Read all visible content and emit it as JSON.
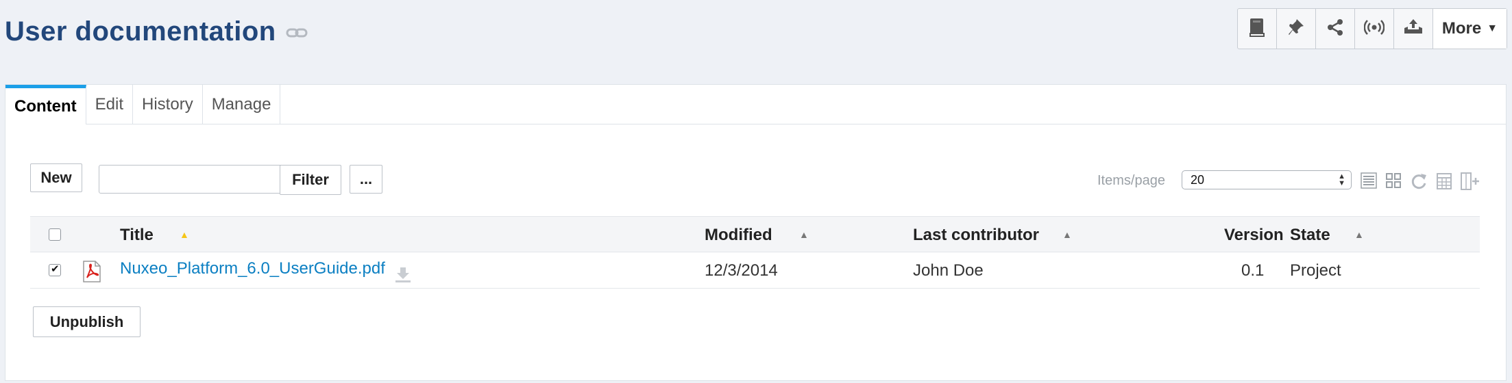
{
  "page": {
    "title": "User documentation"
  },
  "actions": {
    "more_label": "More"
  },
  "tabs": [
    {
      "label": "Content",
      "active": true
    },
    {
      "label": "Edit",
      "active": false
    },
    {
      "label": "History",
      "active": false
    },
    {
      "label": "Manage",
      "active": false
    }
  ],
  "toolbar": {
    "new_label": "New",
    "filter_value": "",
    "filter_label": "Filter",
    "more_options_label": "...",
    "items_per_page_label": "Items/page",
    "items_per_page_value": "20"
  },
  "table": {
    "columns": {
      "title": "Title",
      "modified": "Modified",
      "last_contributor": "Last contributor",
      "version": "Version",
      "state": "State"
    },
    "rows": [
      {
        "title": "Nuxeo_Platform_6.0_UserGuide.pdf",
        "modified": "12/3/2014",
        "last_contributor": "John Doe",
        "version": "0.1",
        "state": "Project",
        "selected": true
      }
    ]
  },
  "footer": {
    "unpublish_label": "Unpublish"
  },
  "colors": {
    "title": "#22477b",
    "active_tab_accent": "#1b9fe8",
    "link": "#0b7fc2",
    "sort_active": "#f5c518",
    "sort_inactive": "#777777",
    "pdf_red": "#d9231e"
  }
}
